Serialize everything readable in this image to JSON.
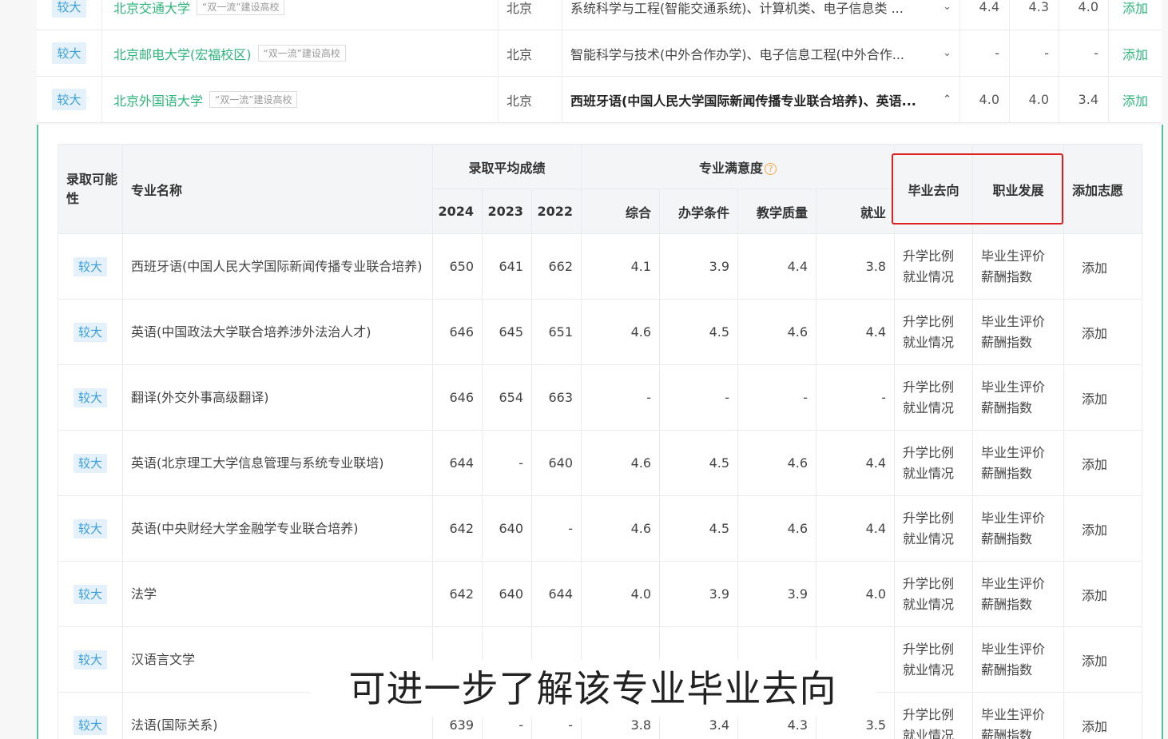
{
  "schools": [
    {
      "prob": "较大",
      "name": "北京交通大学",
      "tag": "“双一流”建设高校",
      "city": "北京",
      "majors": "系统科学与工程(智能交通系统)、计算机类、电子信息类 ...",
      "expand": "⌄",
      "s1": "4.4",
      "s2": "4.3",
      "s3": "4.0",
      "add": "添加",
      "bold": false
    },
    {
      "prob": "较大",
      "name": "北京邮电大学(宏福校区)",
      "tag": "“双一流”建设高校",
      "city": "北京",
      "majors": "智能科学与技术(中外合作办学)、电子信息工程(中外合作...",
      "expand": "⌄",
      "s1": "-",
      "s2": "-",
      "s3": "-",
      "add": "添加",
      "bold": false
    },
    {
      "prob": "较大",
      "name": "北京外国语大学",
      "tag": "“双一流”建设高校",
      "city": "北京",
      "majors": "西班牙语(中国人民大学国际新闻传播专业联合培养)、英语...",
      "expand": "⌃",
      "s1": "4.0",
      "s2": "4.0",
      "s3": "3.4",
      "add": "添加",
      "bold": true
    }
  ],
  "table": {
    "headers": {
      "prob": "录取可能性",
      "name": "专业名称",
      "avg_score": "录取平均成绩",
      "satisfaction": "专业满意度",
      "help_icon": "?",
      "grad": "毕业去向",
      "career": "职业发展",
      "add": "添加志愿",
      "years": [
        "2024",
        "2023",
        "2022"
      ],
      "sat_cols": [
        "综合",
        "办学条件",
        "教学质量",
        "就业"
      ]
    },
    "rows": [
      {
        "prob": "较大",
        "name": "西班牙语(中国人民大学国际新闻传播专业联合培养)",
        "y2024": "650",
        "y2023": "641",
        "y2022": "662",
        "overall": "4.1",
        "cond": "3.9",
        "teach": "4.4",
        "job": "3.8"
      },
      {
        "prob": "较大",
        "name": "英语(中国政法大学联合培养涉外法治人才)",
        "y2024": "646",
        "y2023": "645",
        "y2022": "651",
        "overall": "4.6",
        "cond": "4.5",
        "teach": "4.6",
        "job": "4.4"
      },
      {
        "prob": "较大",
        "name": "翻译(外交外事高级翻译)",
        "y2024": "646",
        "y2023": "654",
        "y2022": "663",
        "overall": "-",
        "cond": "-",
        "teach": "-",
        "job": "-"
      },
      {
        "prob": "较大",
        "name": "英语(北京理工大学信息管理与系统专业联培)",
        "y2024": "644",
        "y2023": "-",
        "y2022": "640",
        "overall": "4.6",
        "cond": "4.5",
        "teach": "4.6",
        "job": "4.4"
      },
      {
        "prob": "较大",
        "name": "英语(中央财经大学金融学专业联合培养)",
        "y2024": "642",
        "y2023": "640",
        "y2022": "-",
        "overall": "4.6",
        "cond": "4.5",
        "teach": "4.6",
        "job": "4.4"
      },
      {
        "prob": "较大",
        "name": "法学",
        "y2024": "642",
        "y2023": "640",
        "y2022": "644",
        "overall": "4.0",
        "cond": "3.9",
        "teach": "3.9",
        "job": "4.0"
      },
      {
        "prob": "较大",
        "name": "汉语言文学",
        "y2024": "",
        "y2023": "",
        "y2022": "",
        "overall": "",
        "cond": "",
        "teach": "",
        "job": ""
      },
      {
        "prob": "较大",
        "name": "法语(国际关系)",
        "y2024": "639",
        "y2023": "-",
        "y2022": "-",
        "overall": "3.8",
        "cond": "3.4",
        "teach": "4.3",
        "job": "3.5"
      }
    ],
    "links": {
      "further_ratio": "升学比例",
      "employment": "就业情况",
      "grad_eval": "毕业生评价",
      "salary": "薪酬指数",
      "add": "添加"
    }
  },
  "subtitle": "可进一步了解该专业毕业去向",
  "colors": {
    "green": "#2db67c",
    "badge_bg": "#e4f1fb",
    "badge_text": "#3aa0dd",
    "highlight": "#e02020",
    "panel_border": "#57c39b"
  }
}
